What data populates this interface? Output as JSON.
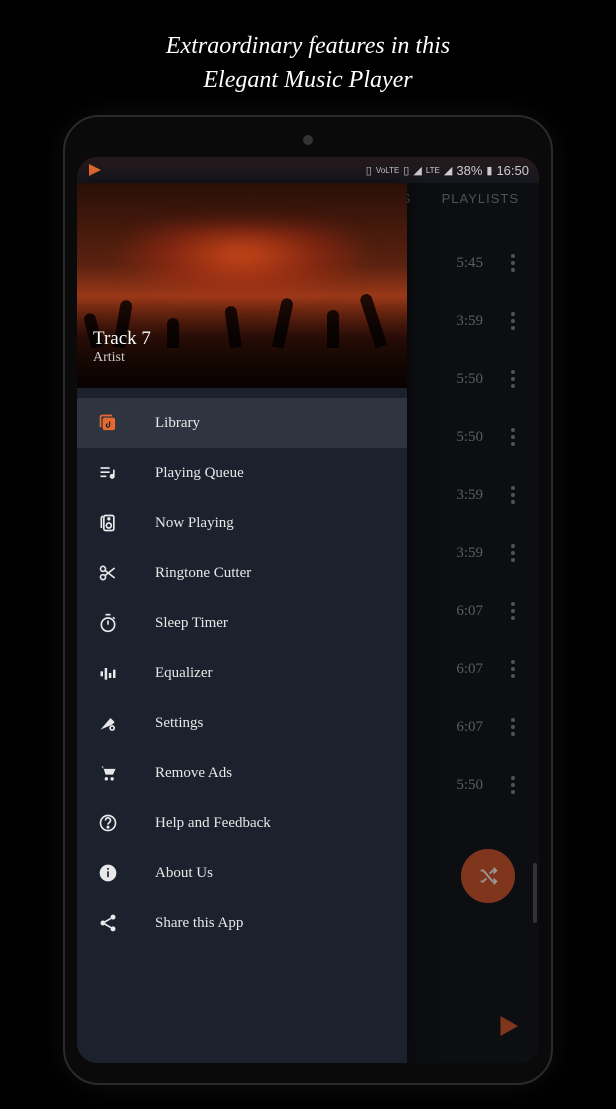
{
  "promo": {
    "line1": "Extraordinary features in this",
    "line2": "Elegant Music Player"
  },
  "status": {
    "battery": "38%",
    "time": "16:50"
  },
  "tabs": {
    "ers": "ERS",
    "playlists": "PLAYLISTS"
  },
  "tracks": [
    {
      "time": "5:45"
    },
    {
      "time": "3:59"
    },
    {
      "time": "5:50"
    },
    {
      "time": "5:50"
    },
    {
      "time": "3:59"
    },
    {
      "time": "3:59"
    },
    {
      "time": "6:07"
    },
    {
      "time": "6:07"
    },
    {
      "time": "6:07"
    },
    {
      "time": "5:50"
    }
  ],
  "drawer": {
    "track_title": "Track 7",
    "track_artist": "Artist",
    "items": [
      {
        "label": "Library",
        "icon": "library",
        "active": true
      },
      {
        "label": "Playing Queue",
        "icon": "queue"
      },
      {
        "label": "Now Playing",
        "icon": "speaker"
      },
      {
        "label": "Ringtone Cutter",
        "icon": "scissors"
      },
      {
        "label": "Sleep Timer",
        "icon": "timer"
      },
      {
        "label": "Equalizer",
        "icon": "equalizer"
      },
      {
        "label": "Settings",
        "icon": "settings"
      },
      {
        "label": "Remove Ads",
        "icon": "cart"
      },
      {
        "label": "Help and Feedback",
        "icon": "help"
      },
      {
        "label": "About Us",
        "icon": "info"
      },
      {
        "label": "Share this App",
        "icon": "share"
      }
    ]
  }
}
